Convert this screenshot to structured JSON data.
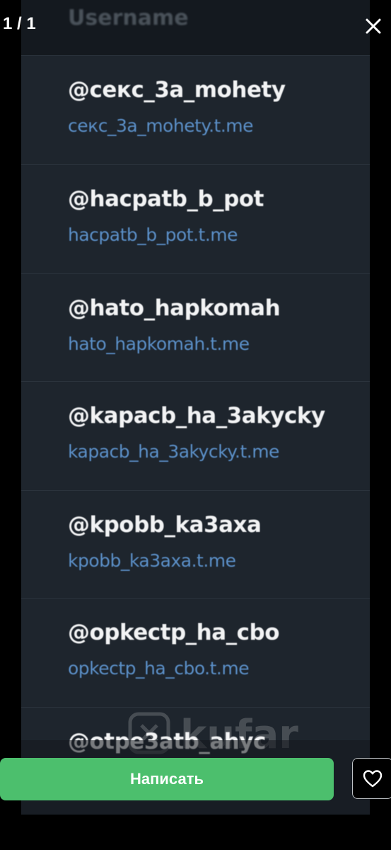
{
  "viewer": {
    "counter": "1 / 1",
    "close_icon": "close-icon",
    "write_button_label": "Написать",
    "favorite_icon": "heart-icon"
  },
  "photo": {
    "header_title": "Username",
    "watermark_text": "kufar",
    "rows": [
      {
        "username": "@секс_3а_mohety",
        "link": "секс_3а_mohety.t.me"
      },
      {
        "username": "@hacpatb_b_pot",
        "link": "hacpatb_b_pot.t.me"
      },
      {
        "username": "@hato_hapkomah",
        "link": "hato_hapkomah.t.me"
      },
      {
        "username": "@kapacb_ha_3akycky",
        "link": "kapacb_ha_3akycky.t.me"
      },
      {
        "username": "@kpobb_ka3axa",
        "link": "kpobb_ka3axa.t.me"
      },
      {
        "username": "@opkectp_ha_cbo",
        "link": "opkectp_ha_cbo.t.me"
      },
      {
        "username": "@otpe3atb_ahyc",
        "link": ""
      }
    ]
  },
  "colors": {
    "button_green": "#4cbf6d",
    "link_blue": "#5b8fc7",
    "panel_bg": "#1e252d"
  }
}
